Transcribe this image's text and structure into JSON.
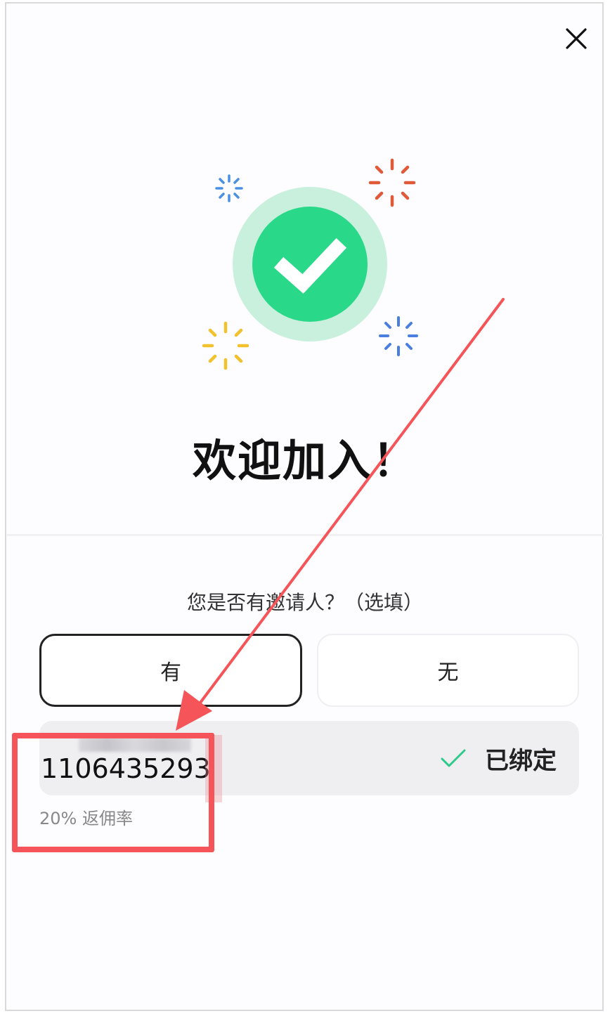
{
  "dialog": {
    "close_icon": "close-icon",
    "title": "欢迎加入！",
    "question": "您是否有邀请人？（选填）",
    "options": {
      "yes": "有",
      "no": "无"
    },
    "selected_option": "有"
  },
  "inviter": {
    "id": "1106435293",
    "rebate": "20% 返佣率",
    "status": "已绑定",
    "status_icon": "check-icon"
  },
  "colors": {
    "success_green": "#2ad88a",
    "success_halo": "#c8f0dd",
    "annotation_red": "#f55558"
  }
}
